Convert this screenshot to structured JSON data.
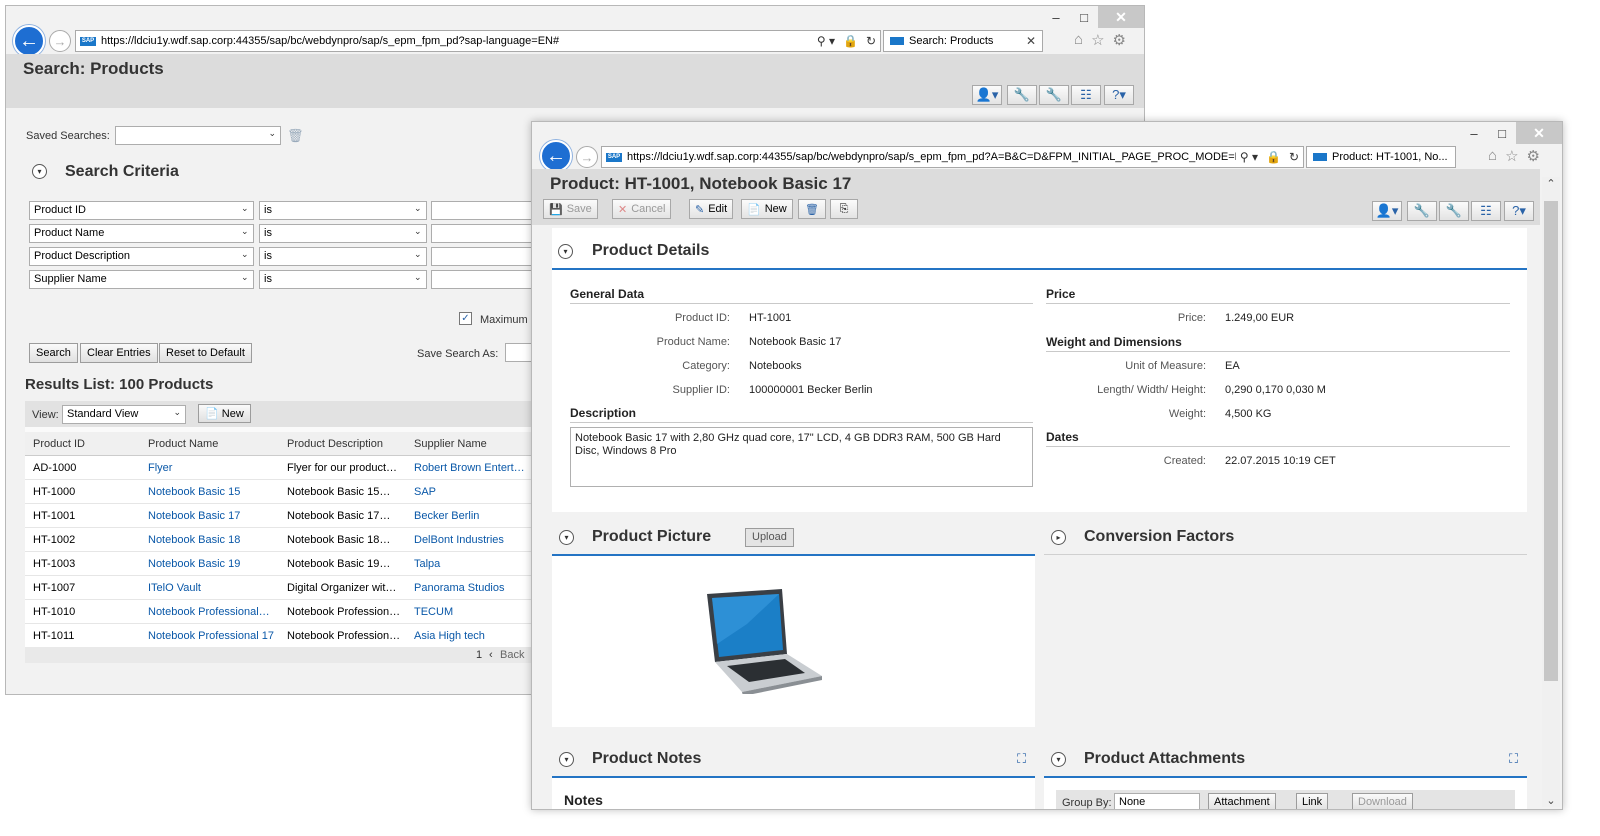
{
  "window_controls": {
    "minimize": "–",
    "maximize": "□",
    "close": "✕"
  },
  "search_window": {
    "url": "https://ldciu1y.wdf.sap.corp:44355/sap/bc/webdynpro/sap/s_epm_fpm_pd?sap-language=EN#",
    "tab_title": "Search: Products",
    "page_title": "Search: Products",
    "saved_searches_label": "Saved Searches:",
    "search_criteria_title": "Search Criteria",
    "criteria": [
      {
        "field": "Product ID",
        "operator": "is"
      },
      {
        "field": "Product Name",
        "operator": "is"
      },
      {
        "field": "Product Description",
        "operator": "is"
      },
      {
        "field": "Supplier Name",
        "operator": "is"
      }
    ],
    "maximum_label": "Maximum N",
    "buttons": {
      "search": "Search",
      "clear": "Clear Entries",
      "reset": "Reset to Default"
    },
    "save_search_as_label": "Save Search As:",
    "results_title": "Results List: 100 Products",
    "view_label": "View:",
    "view_value": "Standard View",
    "new_label": "New",
    "columns": [
      "Product ID",
      "Product Name",
      "Product Description",
      "Supplier Name"
    ],
    "rows": [
      [
        "AD-1000",
        "Flyer",
        "Flyer for our product…",
        "Robert Brown Entert…"
      ],
      [
        "HT-1000",
        "Notebook Basic 15",
        "Notebook Basic 15…",
        "SAP"
      ],
      [
        "HT-1001",
        "Notebook Basic 17",
        "Notebook Basic 17…",
        "Becker Berlin"
      ],
      [
        "HT-1002",
        "Notebook Basic 18",
        "Notebook Basic 18…",
        "DelBont Industries"
      ],
      [
        "HT-1003",
        "Notebook Basic 19",
        "Notebook Basic 19…",
        "Talpa"
      ],
      [
        "HT-1007",
        "ITelO Vault",
        "Digital Organizer wit…",
        "Panorama Studios"
      ],
      [
        "HT-1010",
        "Notebook Professional…",
        "Notebook Profession…",
        "TECUM"
      ],
      [
        "HT-1011",
        "Notebook Professional 17",
        "Notebook Profession…",
        "Asia High tech"
      ]
    ],
    "pager_page": "1",
    "pager_back": "Back"
  },
  "detail_window": {
    "url": "https://ldciu1y.wdf.sap.corp:44355/sap/bc/webdynpro/sap/s_epm_fpm_pd?A=B&C=D&FPM_INITIAL_PAGE_PROC_MODE=L&FPM_",
    "tab_title": "Product: HT-1001, No...",
    "page_title": "Product: HT-1001, Notebook Basic 17",
    "toolbar": {
      "save": "Save",
      "cancel": "Cancel",
      "edit": "Edit",
      "new": "New"
    },
    "product_details_title": "Product Details",
    "general_data_title": "General Data",
    "general_fields": [
      {
        "label": "Product ID:",
        "value": "HT-1001"
      },
      {
        "label": "Product Name:",
        "value": "Notebook Basic 17"
      },
      {
        "label": "Category:",
        "value": "Notebooks"
      },
      {
        "label": "Supplier ID:",
        "value": "100000001 Becker Berlin"
      }
    ],
    "description_title": "Description",
    "description_text": "Notebook Basic 17 with 2,80 GHz quad core, 17\" LCD, 4 GB DDR3 RAM, 500 GB Hard Disc, Windows 8 Pro",
    "price_title": "Price",
    "price_label": "Price:",
    "price_value": "1.249,00 EUR",
    "weight_dim_title": "Weight and Dimensions",
    "weight_fields": [
      {
        "label": "Unit of Measure:",
        "value": "EA"
      },
      {
        "label": "Length/ Width/ Height:",
        "value": "0,290 0,170 0,030 M"
      },
      {
        "label": "Weight:",
        "value": "4,500 KG"
      }
    ],
    "dates_title": "Dates",
    "created_label": "Created:",
    "created_value": "22.07.2015 10:19 CET",
    "product_picture_title": "Product Picture",
    "upload_label": "Upload",
    "conversion_factors_title": "Conversion Factors",
    "product_notes_title": "Product Notes",
    "notes_label": "Notes",
    "product_attachments_title": "Product Attachments",
    "attach_toolbar": {
      "group_by": "Group By:",
      "group_value": "None",
      "attachment": "Attachment",
      "link": "Link",
      "download": "Download"
    }
  }
}
